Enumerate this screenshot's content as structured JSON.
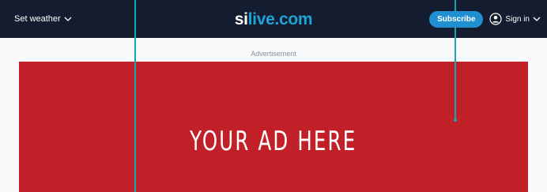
{
  "header": {
    "weather_label": "Set weather",
    "logo_prefix": "si",
    "logo_suffix": "live.com",
    "subscribe_label": "Subscribe",
    "signin_label": "Sign in"
  },
  "ad": {
    "label": "Advertisement",
    "text": "YOUR AD HERE"
  },
  "colors": {
    "header_bg": "#141c30",
    "accent": "#1f8fd0",
    "ad_bg": "#c12029",
    "pin": "#15a6b5"
  }
}
